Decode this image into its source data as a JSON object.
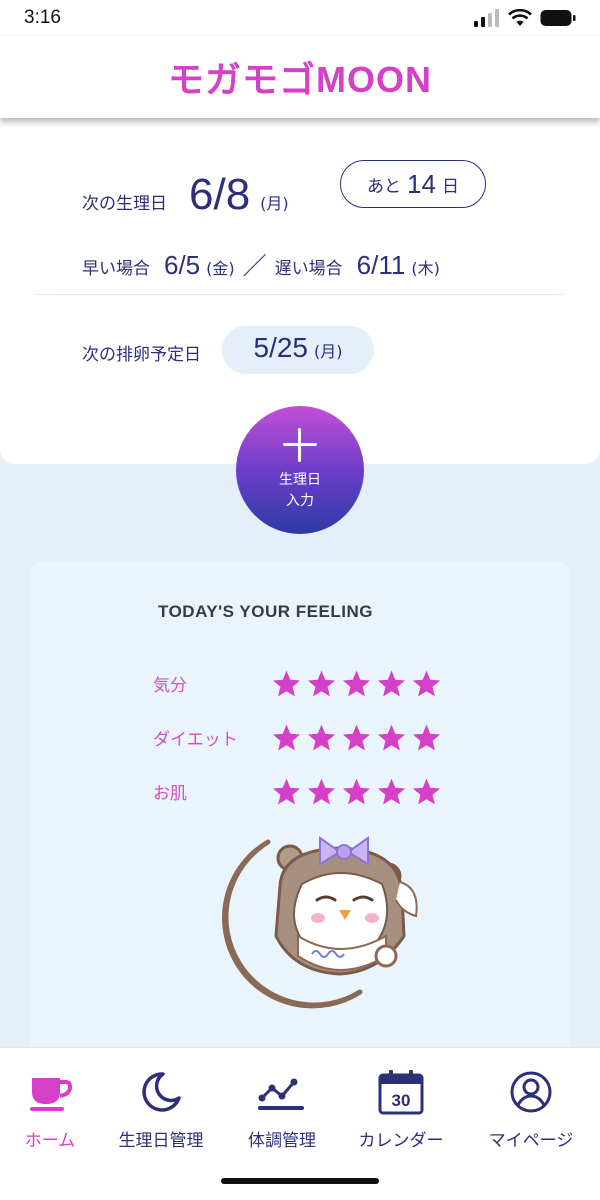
{
  "status_bar": {
    "time": "3:16"
  },
  "header": {
    "app_title": "モガモゴMOON"
  },
  "next_period": {
    "label": "次の生理日",
    "date": "6/8",
    "weekday": "(月)",
    "remaining_prefix": "あと",
    "remaining_days": "14",
    "remaining_suffix": "日"
  },
  "range": {
    "early_label": "早い場合",
    "early_date": "6/5",
    "early_weekday": "(金)",
    "separator": "／",
    "late_label": "遅い場合",
    "late_date": "6/11",
    "late_weekday": "(木)"
  },
  "ovulation": {
    "label": "次の排卵予定日",
    "date": "5/25",
    "weekday": "(月)"
  },
  "add_button": {
    "line1": "生理日",
    "line2": "入力"
  },
  "feeling": {
    "title": "TODAY'S YOUR FEELING",
    "star_color": "#d63fc7",
    "rows": [
      {
        "label": "気分",
        "rating": 5
      },
      {
        "label": "ダイエット",
        "rating": 5
      },
      {
        "label": "お肌",
        "rating": 5
      }
    ]
  },
  "nav": {
    "items": [
      {
        "label": "ホーム",
        "icon": "cup-icon",
        "active": true
      },
      {
        "label": "生理日管理",
        "icon": "moon-icon",
        "active": false
      },
      {
        "label": "体調管理",
        "icon": "line-chart-icon",
        "active": false
      },
      {
        "label": "カレンダー",
        "icon": "calendar-icon",
        "active": false,
        "icon_text": "30"
      },
      {
        "label": "マイページ",
        "icon": "user-icon",
        "active": false
      }
    ]
  },
  "colors": {
    "primary": "#2c2f7a",
    "accent": "#d63fc7",
    "background": "#e4effa"
  }
}
